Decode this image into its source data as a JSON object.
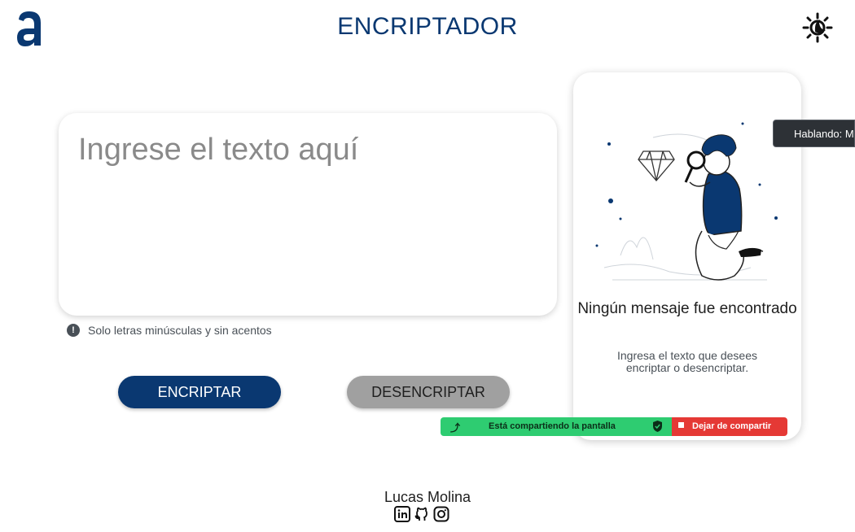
{
  "header": {
    "logo_icon": "alura-a-logo",
    "title": "ENCRIPTADOR",
    "theme_icon": "sun-moon-icon"
  },
  "input": {
    "placeholder": "Ingrese el texto aquí",
    "value": "",
    "hint": "Solo letras minúsculas y sin acentos",
    "hint_icon": "exclamation-icon"
  },
  "buttons": {
    "encrypt": "ENCRIPTAR",
    "decrypt": "DESENCRIPTAR"
  },
  "output": {
    "title": "Ningún mensaje fue encontrado",
    "text": "Ingresa el texto que desees encriptar o desencriptar.",
    "illustration_icon": "person-magnifier-illustration"
  },
  "overlay": {
    "speaking": "Hablando: M",
    "share_text": "Está compartiendo la pantalla",
    "stop_share": "Dejar de compartir"
  },
  "footer": {
    "name": "Lucas Molina",
    "socials": [
      "linkedin-icon",
      "github-icon",
      "instagram-icon"
    ]
  },
  "colors": {
    "primary": "#0a3871",
    "secondary": "#a0a0a0",
    "share_green": "#2ecc71",
    "share_red": "#e53935"
  }
}
